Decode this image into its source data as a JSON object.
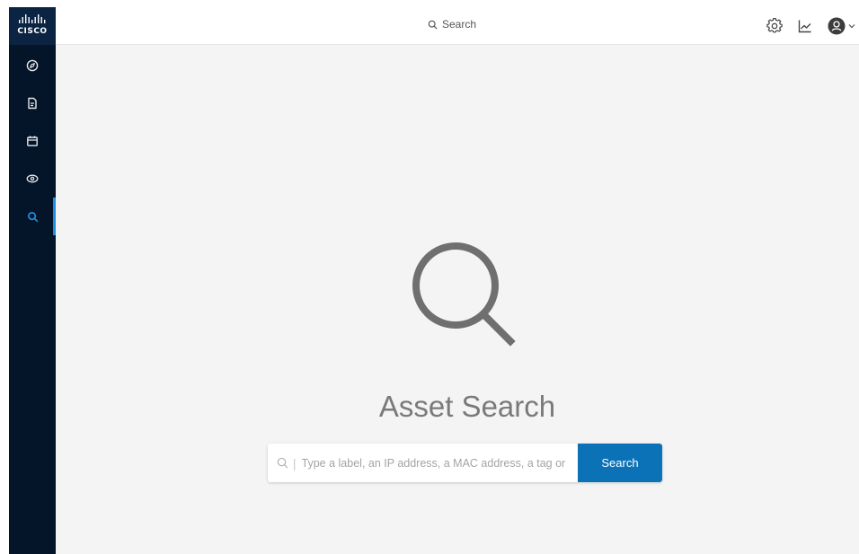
{
  "brand": {
    "logo_text": "CISCO"
  },
  "sidebar": {
    "items": [
      {
        "icon": "compass-icon",
        "active": false
      },
      {
        "icon": "document-icon",
        "active": false
      },
      {
        "icon": "calendar-icon",
        "active": false
      },
      {
        "icon": "eye-icon",
        "active": false
      },
      {
        "icon": "search-icon",
        "active": true
      }
    ],
    "accent_color": "#1e90e0"
  },
  "topbar": {
    "search_label": "Search",
    "icons": [
      "gear-icon",
      "chart-line-icon",
      "user-avatar-icon",
      "chevron-down-icon"
    ]
  },
  "main": {
    "title": "Asset Search",
    "search_placeholder": "Type a label, an IP address, a MAC address, a tag or",
    "search_button_label": "Search",
    "button_color": "#0b72b8"
  }
}
